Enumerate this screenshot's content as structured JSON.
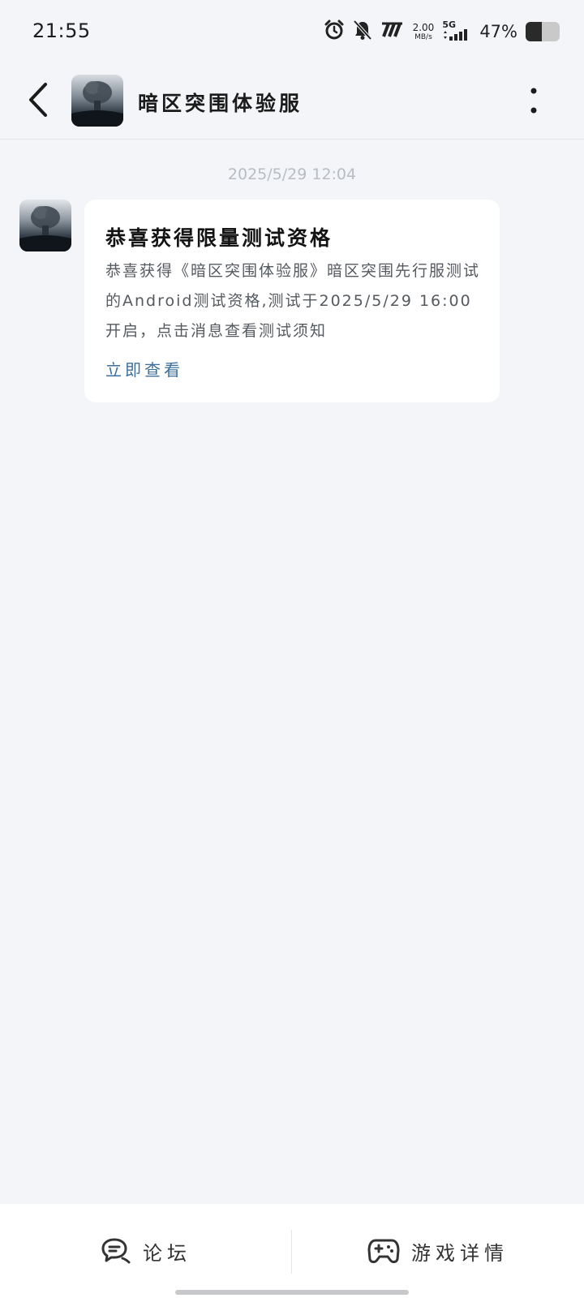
{
  "status_bar": {
    "time": "21:55",
    "speed_value": "2.00",
    "speed_unit": "MB/s",
    "network": "5G",
    "battery_percent": "47%",
    "battery_level": 0.47,
    "icons": [
      "alarm-icon",
      "bell-muted-icon",
      "nfc-icon",
      "signal-icon",
      "battery-icon"
    ]
  },
  "header": {
    "title": "暗区突围体验服",
    "back_icon": "back-chevron-icon",
    "menu_icon": "more-vertical-icon"
  },
  "chat": {
    "timestamp": "2025/5/29  12:04",
    "message": {
      "title": "恭喜获得限量测试资格",
      "body": "恭喜获得《暗区突围体验服》暗区突围先行服测试的Android测试资格,测试于2025/5/29 16:00 开启，点击消息查看测试须知",
      "link": "立即查看"
    }
  },
  "bottom_bar": {
    "forum_label": "论坛",
    "game_details_label": "游戏详情",
    "forum_icon": "chat-bubble-icon",
    "game_icon": "gamepad-icon"
  },
  "colors": {
    "background": "#f3f5f8",
    "card": "#ffffff",
    "link": "#3c6f9c",
    "timestamp": "#b8bcc3"
  }
}
